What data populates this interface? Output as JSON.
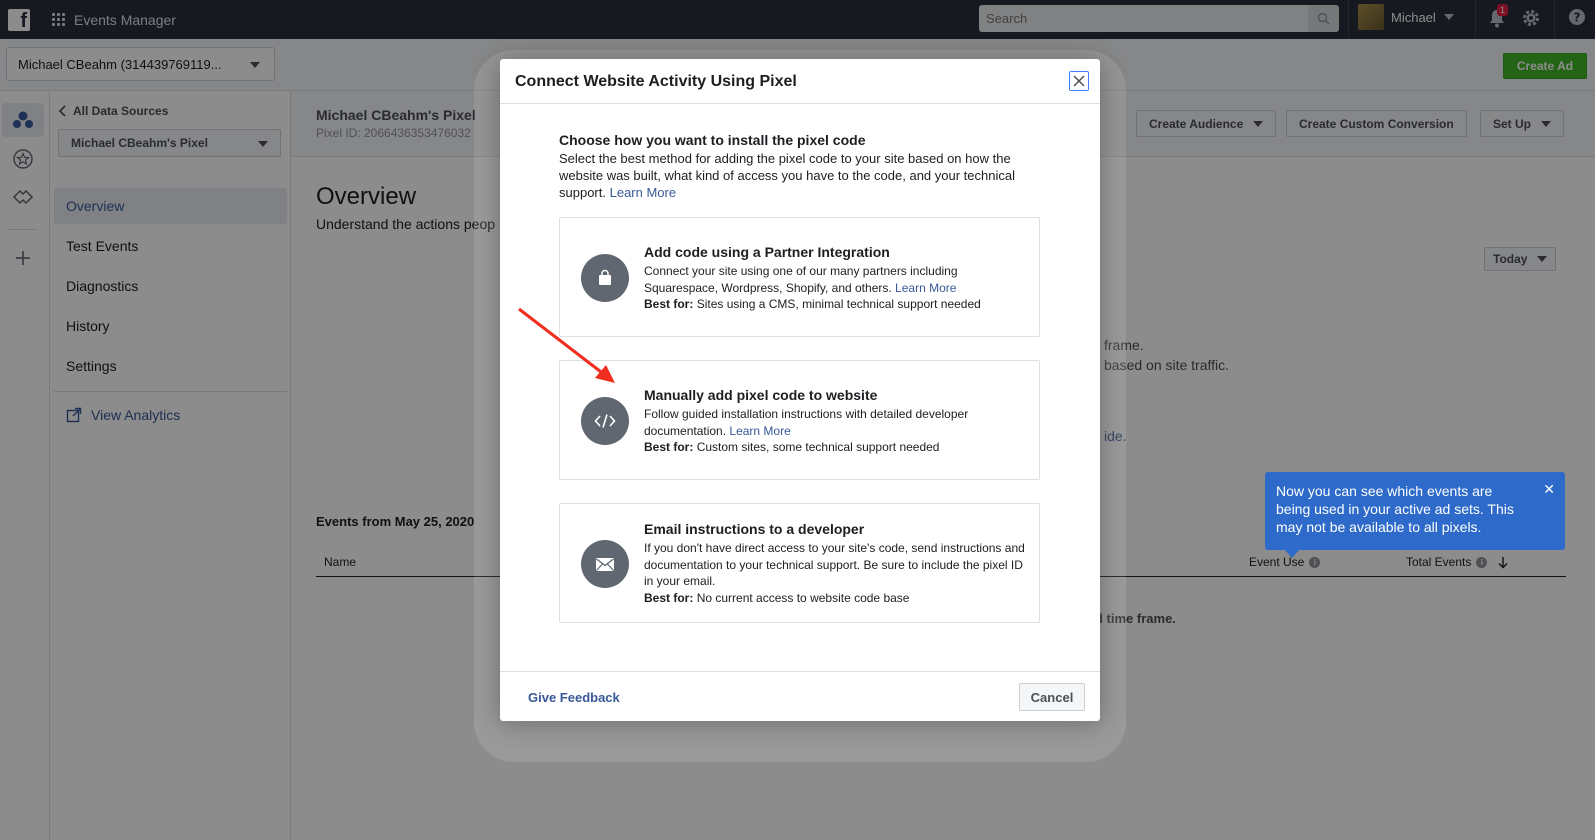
{
  "topbar": {
    "app_title": "Events Manager",
    "search_placeholder": "Search",
    "user_name": "Michael",
    "notification_count": "1"
  },
  "subbar": {
    "account": "Michael CBeahm (314439769119...",
    "create_ad": "Create Ad"
  },
  "sidebar": {
    "back_label": "All Data Sources",
    "pixel_select": "Michael CBeahm's Pixel",
    "items": [
      {
        "label": "Overview",
        "active": true
      },
      {
        "label": "Test Events"
      },
      {
        "label": "Diagnostics"
      },
      {
        "label": "History"
      },
      {
        "label": "Settings"
      }
    ],
    "view_analytics": "View Analytics"
  },
  "main": {
    "pixel_name": "Michael CBeahm's Pixel",
    "pixel_id": "Pixel ID: 2066436353476032",
    "buttons": {
      "create_audience": "Create Audience",
      "create_custom_conversion": "Create Custom Conversion",
      "set_up": "Set Up"
    },
    "overview_title": "Overview",
    "overview_sub": "Understand the actions peop",
    "today": "Today",
    "bg_line1": "frame.",
    "bg_line2": "based on site traffic.",
    "bg_link": "ide.",
    "events_from": "Events from May 25, 2020",
    "table": {
      "col_name": "Name",
      "col_event_use": "Event Use",
      "col_total_events": "Total Events"
    },
    "bg_empty": "d time frame.",
    "tooltip": "Now you can see which events are being used in your active ad sets. This may not be available to all pixels."
  },
  "modal": {
    "title": "Connect Website Activity Using Pixel",
    "intro_title": "Choose how you want to install the pixel code",
    "intro_text": "Select the best method for adding the pixel code to your site based on how the website was built, what kind of access you have to the code, and your technical support.",
    "intro_link": "Learn More",
    "options": [
      {
        "title": "Add code using a Partner Integration",
        "desc": "Connect your site using one of our many partners including Squarespace, Wordpress, Shopify, and others.",
        "link": "Learn More",
        "best_label": "Best for:",
        "best_text": "Sites using a CMS, minimal technical support needed",
        "icon": "shopping-bag-icon"
      },
      {
        "title": "Manually add pixel code to website",
        "desc": "Follow guided installation instructions with detailed developer documentation.",
        "link": "Learn More",
        "best_label": "Best for:",
        "best_text": "Custom sites, some technical support needed",
        "icon": "code-icon"
      },
      {
        "title": "Email instructions to a developer",
        "desc": "If you don't have direct access to your site's code, send instructions and documentation to your technical support. Be sure to include the pixel ID in your email.",
        "best_label": "Best for:",
        "best_text": "No current access to website code base",
        "icon": "envelope-icon"
      }
    ],
    "give_feedback": "Give Feedback",
    "cancel": "Cancel"
  },
  "colors": {
    "accent_blue": "#385898",
    "create_ad_green": "#42b72a",
    "tooltip_blue": "#2d6ac9",
    "annotation_arrow": "#f02d1e"
  }
}
